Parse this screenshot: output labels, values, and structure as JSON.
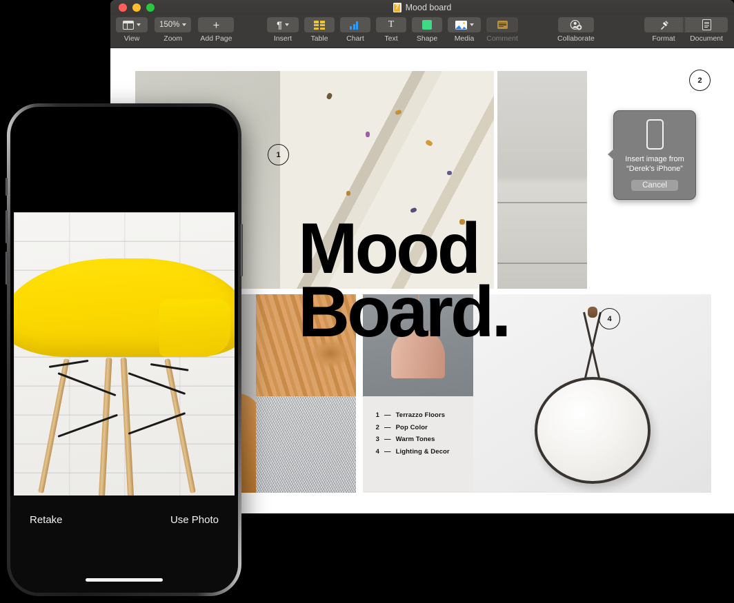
{
  "window": {
    "title": "Mood board",
    "doc_icon": "pages-document-icon",
    "traffic_lights": [
      "close",
      "minimize",
      "maximize"
    ]
  },
  "toolbar": {
    "left_group": [
      {
        "label": "View",
        "icon": "view-panel-icon",
        "has_chevron": true,
        "value": ""
      },
      {
        "label": "Zoom",
        "icon": "zoom-value",
        "has_chevron": true,
        "value": "150%"
      },
      {
        "label": "Add Page",
        "icon": "plus-icon",
        "has_chevron": false,
        "value": ""
      }
    ],
    "center_group": [
      {
        "label": "Insert",
        "icon": "pilcrow-icon",
        "has_chevron": true,
        "disabled": false
      },
      {
        "label": "Table",
        "icon": "table-icon",
        "has_chevron": false,
        "disabled": false
      },
      {
        "label": "Chart",
        "icon": "chart-icon",
        "has_chevron": false,
        "disabled": false
      },
      {
        "label": "Text",
        "icon": "text-t-icon",
        "has_chevron": false,
        "disabled": false
      },
      {
        "label": "Shape",
        "icon": "shape-icon",
        "has_chevron": false,
        "disabled": false
      },
      {
        "label": "Media",
        "icon": "media-icon",
        "has_chevron": true,
        "disabled": false
      },
      {
        "label": "Comment",
        "icon": "comment-icon",
        "has_chevron": false,
        "disabled": true
      }
    ],
    "collaborate": {
      "label": "Collaborate",
      "icon": "collaborate-person-add-icon"
    },
    "right_group": [
      {
        "label": "Format",
        "icon": "format-brush-icon"
      },
      {
        "label": "Document",
        "icon": "document-icon"
      }
    ]
  },
  "document": {
    "title_line1": "Mood",
    "title_line2": "Board.",
    "badges": [
      {
        "number": "1"
      },
      {
        "number": "2"
      },
      {
        "number": "4"
      }
    ],
    "legend": [
      {
        "num": "1",
        "dash": "—",
        "label": "Terrazzo Floors"
      },
      {
        "num": "2",
        "dash": "—",
        "label": "Pop Color"
      },
      {
        "num": "3",
        "dash": "—",
        "label": "Warm Tones"
      },
      {
        "num": "4",
        "dash": "—",
        "label": "Lighting & Decor"
      }
    ]
  },
  "popover": {
    "icon": "iphone-device-icon",
    "line1": "Insert image from",
    "line2": "“Derek’s iPhone”",
    "cancel_label": "Cancel"
  },
  "iphone": {
    "retake_label": "Retake",
    "use_photo_label": "Use Photo"
  },
  "colors": {
    "toolbar_bg": "#3b3a38",
    "button_bg": "#565552",
    "popover_bg": "#7f7f7f",
    "accent_yellow": "#ffe20a",
    "close": "#ff5f57",
    "minimize": "#febc2e",
    "maximize": "#28c840"
  }
}
